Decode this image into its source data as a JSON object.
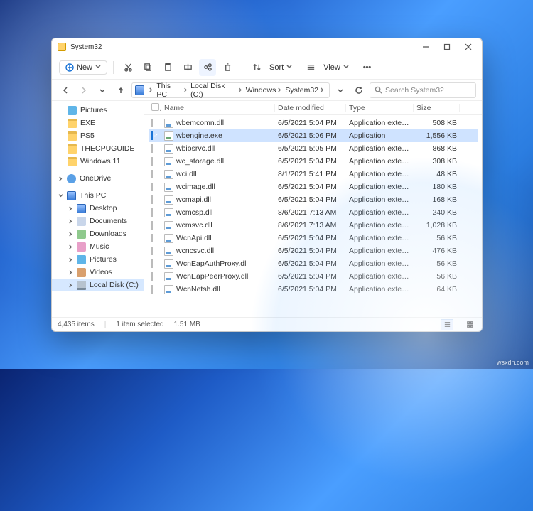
{
  "window": {
    "title": "System32"
  },
  "toolbar": {
    "new": "New",
    "sort": "Sort",
    "view": "View"
  },
  "breadcrumb": [
    "This PC",
    "Local Disk (C:)",
    "Windows",
    "System32"
  ],
  "search": {
    "placeholder": "Search System32"
  },
  "sidebar": {
    "quick": [
      {
        "label": "Pictures"
      },
      {
        "label": "EXE"
      },
      {
        "label": "PS5"
      },
      {
        "label": "THECPUGUIDE"
      },
      {
        "label": "Windows 11"
      }
    ],
    "onedrive": "OneDrive",
    "thispc": {
      "label": "This PC",
      "children": [
        "Desktop",
        "Documents",
        "Downloads",
        "Music",
        "Pictures",
        "Videos",
        "Local Disk (C:)"
      ]
    }
  },
  "columns": [
    "Name",
    "Date modified",
    "Type",
    "Size"
  ],
  "files": [
    {
      "name": "wbemcomn.dll",
      "date": "6/5/2021 5:04 PM",
      "type": "Application exten...",
      "size": "508 KB",
      "icon": "dll"
    },
    {
      "name": "wbengine.exe",
      "date": "6/5/2021 5:06 PM",
      "type": "Application",
      "size": "1,556 KB",
      "icon": "exe",
      "selected": true
    },
    {
      "name": "wbiosrvc.dll",
      "date": "6/5/2021 5:05 PM",
      "type": "Application exten...",
      "size": "868 KB",
      "icon": "dll"
    },
    {
      "name": "wc_storage.dll",
      "date": "6/5/2021 5:04 PM",
      "type": "Application exten...",
      "size": "308 KB",
      "icon": "dll"
    },
    {
      "name": "wci.dll",
      "date": "8/1/2021 5:41 PM",
      "type": "Application exten...",
      "size": "48 KB",
      "icon": "dll"
    },
    {
      "name": "wcimage.dll",
      "date": "6/5/2021 5:04 PM",
      "type": "Application exten...",
      "size": "180 KB",
      "icon": "dll"
    },
    {
      "name": "wcmapi.dll",
      "date": "6/5/2021 5:04 PM",
      "type": "Application exten...",
      "size": "168 KB",
      "icon": "dll"
    },
    {
      "name": "wcmcsp.dll",
      "date": "8/6/2021 7:13 AM",
      "type": "Application exten...",
      "size": "240 KB",
      "icon": "dll"
    },
    {
      "name": "wcmsvc.dll",
      "date": "8/6/2021 7:13 AM",
      "type": "Application exten...",
      "size": "1,028 KB",
      "icon": "dll"
    },
    {
      "name": "WcnApi.dll",
      "date": "6/5/2021 5:04 PM",
      "type": "Application exten...",
      "size": "56 KB",
      "icon": "dll"
    },
    {
      "name": "wcncsvc.dll",
      "date": "6/5/2021 5:04 PM",
      "type": "Application exten...",
      "size": "476 KB",
      "icon": "dll"
    },
    {
      "name": "WcnEapAuthProxy.dll",
      "date": "6/5/2021 5:04 PM",
      "type": "Application exten...",
      "size": "56 KB",
      "icon": "dll"
    },
    {
      "name": "WcnEapPeerProxy.dll",
      "date": "6/5/2021 5:04 PM",
      "type": "Application exten...",
      "size": "56 KB",
      "icon": "dll"
    },
    {
      "name": "WcnNetsh.dll",
      "date": "6/5/2021 5:04 PM",
      "type": "Application exten...",
      "size": "64 KB",
      "icon": "dll"
    }
  ],
  "status": {
    "count": "4,435 items",
    "selection": "1 item selected",
    "size": "1.51 MB"
  },
  "watermark": "wsxdn.com"
}
